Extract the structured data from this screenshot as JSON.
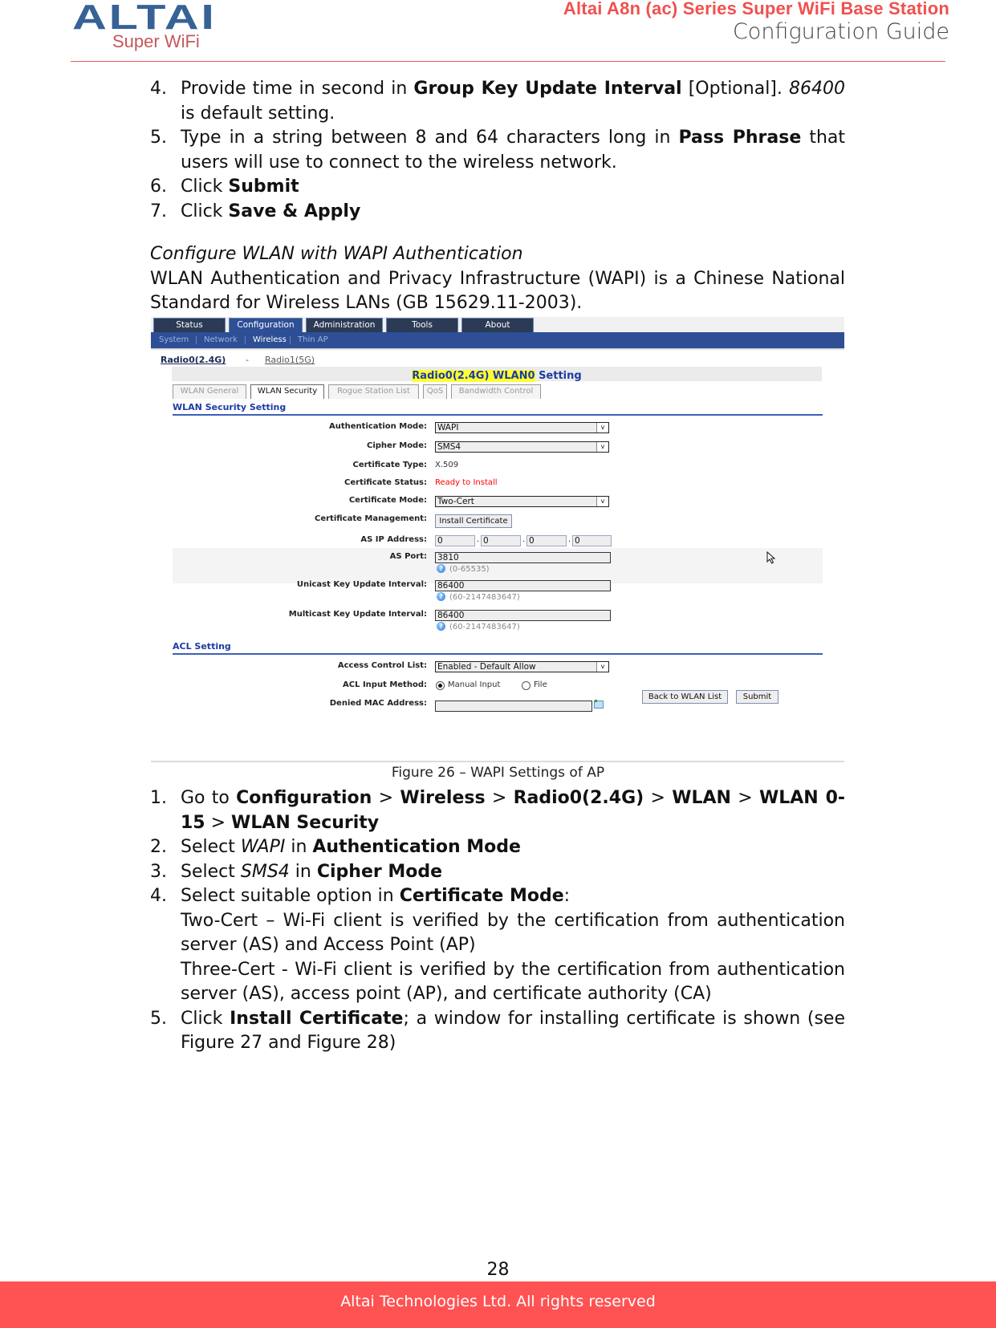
{
  "header": {
    "logo_text": "ALTAI",
    "logo_subtext": "Super WiFi",
    "title": "Altai A8n (ac) Series Super WiFi Base Station",
    "subtitle": "Configuration Guide",
    "colors": {
      "brand_blue": "#376296",
      "brand_red": "#f0504f",
      "footer_red": "#ff5252"
    }
  },
  "steps_top": [
    {
      "num": "4.",
      "parts": [
        {
          "t": "Provide time in second in ",
          "s": ""
        },
        {
          "t": "Group Key Update Interval",
          "s": "b"
        },
        {
          "t": " [Optional]. ",
          "s": ""
        },
        {
          "t": "86400",
          "s": "i"
        },
        {
          "t": " is default setting.",
          "s": ""
        }
      ]
    },
    {
      "num": "5.",
      "parts": [
        {
          "t": "Type in a string between 8 and 64 characters long in ",
          "s": ""
        },
        {
          "t": "Pass Phrase",
          "s": "b"
        },
        {
          "t": " that users will use to connect to the wireless network.",
          "s": ""
        }
      ]
    },
    {
      "num": "6.",
      "parts": [
        {
          "t": "Click ",
          "s": ""
        },
        {
          "t": "Submit",
          "s": "b"
        }
      ]
    },
    {
      "num": "7.",
      "parts": [
        {
          "t": "Click ",
          "s": ""
        },
        {
          "t": "Save & Apply",
          "s": "b"
        }
      ]
    }
  ],
  "section": {
    "heading": "Configure WLAN with WAPI Authentication",
    "intro": "WLAN Authentication and Privacy Infrastructure (WAPI) is a Chinese National Standard for Wireless LANs (GB 15629.11-2003)."
  },
  "figure": {
    "top_tabs": [
      "Status",
      "Configuration",
      "Administration",
      "Tools",
      "About"
    ],
    "active_top_tab": "Configuration",
    "sub_tabs": [
      "System",
      "Network",
      "Wireless",
      "Thin AP"
    ],
    "active_sub_tab": "Wireless",
    "radio_links": {
      "radio0": "Radio0(2.4G)",
      "separator": "-",
      "radio1": "Radio1(5G)"
    },
    "page_title_highlight": "Radio0(2.4G) WLAN0",
    "page_title_rest": " Setting",
    "wlan_tabs": [
      "WLAN General",
      "WLAN Security",
      "Rogue Station List",
      "QoS",
      "Bandwidth Control"
    ],
    "active_wlan_tab": "WLAN Security",
    "security_section": "WLAN Security Setting",
    "fields": {
      "auth_mode": {
        "label": "Authentication Mode:",
        "value": "WAPI"
      },
      "cipher_mode": {
        "label": "Cipher Mode:",
        "value": "SMS4"
      },
      "cert_type": {
        "label": "Certificate Type:",
        "value": "X.509"
      },
      "cert_status": {
        "label": "Certificate Status:",
        "value": "Ready to Install",
        "color": "#ff0000"
      },
      "cert_mode": {
        "label": "Certificate Mode:",
        "value": "Two-Cert"
      },
      "cert_mgmt": {
        "label": "Certificate Management:",
        "button": "Install Certificate"
      },
      "as_ip": {
        "label": "AS IP Address:",
        "octets": [
          "0",
          "0",
          "0",
          "0"
        ],
        "dot": "."
      },
      "as_port": {
        "label": "AS Port:",
        "value": "3810",
        "hint": "(0-65535)"
      },
      "unicast": {
        "label": "Unicast Key Update Interval:",
        "value": "86400",
        "hint": "(60-2147483647)"
      },
      "multicast": {
        "label": "Multicast Key Update Interval:",
        "value": "86400",
        "hint": "(60-2147483647)"
      }
    },
    "acl_section": "ACL Setting",
    "acl": {
      "list": {
        "label": "Access Control List:",
        "value": "Enabled - Default Allow"
      },
      "input_method": {
        "label": "ACL Input Method:",
        "options": [
          "Manual Input",
          "File"
        ],
        "selected": "Manual Input"
      },
      "denied_mac": {
        "label": "Denied MAC Address:",
        "value": ""
      }
    },
    "buttons": {
      "back": "Back to WLAN List",
      "submit": "Submit"
    },
    "help_glyph": "?",
    "arrow_glyph": "v"
  },
  "caption": "Figure 26 – WAPI Settings of AP",
  "steps_bottom": [
    {
      "num": "1.",
      "parts": [
        {
          "t": "Go to ",
          "s": ""
        },
        {
          "t": "Configuration",
          "s": "b"
        },
        {
          "t": " > ",
          "s": ""
        },
        {
          "t": "Wireless",
          "s": "b"
        },
        {
          "t": " > ",
          "s": ""
        },
        {
          "t": "Radio0(2.4G)",
          "s": "b"
        },
        {
          "t": " > ",
          "s": ""
        },
        {
          "t": "WLAN",
          "s": "b"
        },
        {
          "t": " > ",
          "s": ""
        },
        {
          "t": "WLAN 0-15",
          "s": "b"
        },
        {
          "t": " > ",
          "s": ""
        },
        {
          "t": "WLAN Security",
          "s": "b"
        }
      ]
    },
    {
      "num": "2.",
      "parts": [
        {
          "t": "Select ",
          "s": ""
        },
        {
          "t": "WAPI",
          "s": "i"
        },
        {
          "t": " in ",
          "s": ""
        },
        {
          "t": "Authentication Mode",
          "s": "b"
        }
      ]
    },
    {
      "num": "3.",
      "parts": [
        {
          "t": "Select ",
          "s": ""
        },
        {
          "t": "SMS4",
          "s": "i"
        },
        {
          "t": " in ",
          "s": ""
        },
        {
          "t": "Cipher Mode",
          "s": "b"
        }
      ]
    },
    {
      "num": "4.",
      "parts": [
        {
          "t": "Select suitable option in ",
          "s": ""
        },
        {
          "t": "Certificate Mode",
          "s": "b"
        },
        {
          "t": ":",
          "s": ""
        }
      ]
    }
  ],
  "cert_options": [
    "Two-Cert – Wi-Fi client is verified by the certification from authentication server (AS) and Access Point (AP)",
    "Three-Cert - Wi-Fi client is verified by the certification from authentication server (AS), access point (AP), and certificate authority (CA)"
  ],
  "step5": {
    "num": "5.",
    "parts": [
      {
        "t": "Click ",
        "s": ""
      },
      {
        "t": "Install Certificate",
        "s": "b"
      },
      {
        "t": "; a window for installing certificate is shown (see Figure 27 and Figure 28)",
        "s": ""
      }
    ]
  },
  "footer": {
    "page_number": "28",
    "copyright": "Altai Technologies Ltd. All rights reserved"
  }
}
